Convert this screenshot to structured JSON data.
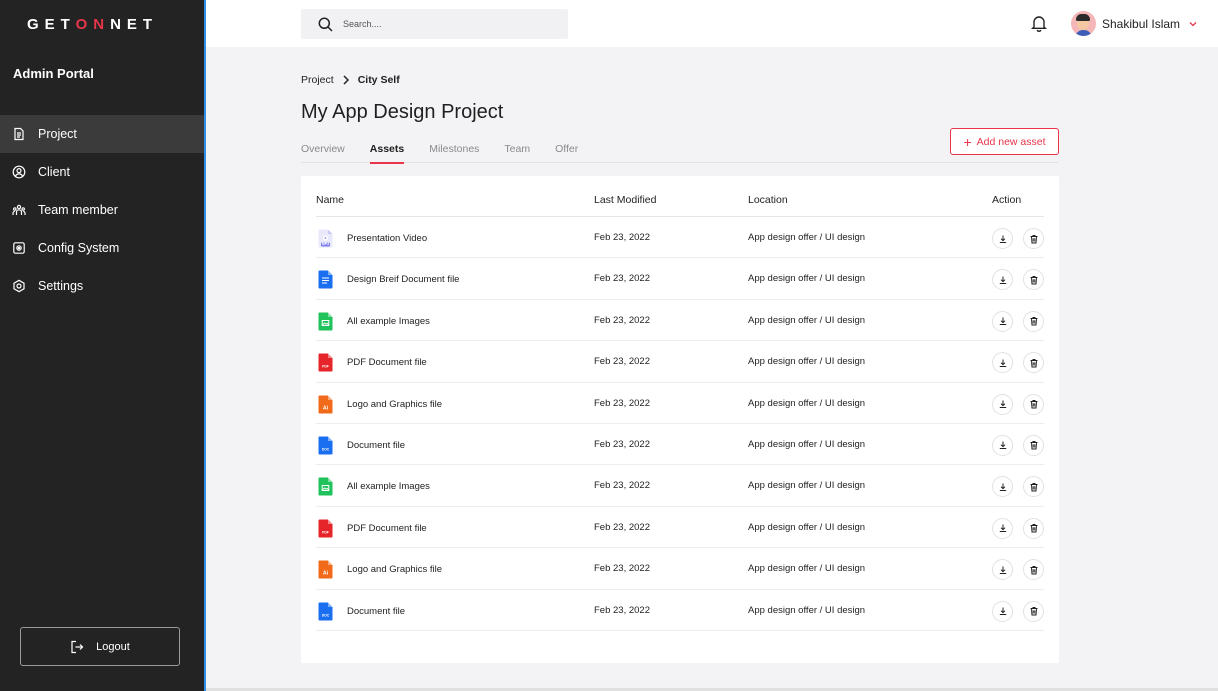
{
  "brand": {
    "logo_pre": "GET",
    "logo_accent": "ON",
    "logo_post": "NET",
    "portal": "Admin Portal"
  },
  "sidebar": {
    "items": [
      {
        "label": "Project",
        "icon": "document-icon"
      },
      {
        "label": "Client",
        "icon": "user-circle-icon"
      },
      {
        "label": "Team member",
        "icon": "team-icon"
      },
      {
        "label": "Config System",
        "icon": "config-icon"
      },
      {
        "label": "Settings",
        "icon": "settings-icon"
      }
    ],
    "logout": "Logout"
  },
  "topbar": {
    "search_placeholder": "Search....",
    "user_name": "Shakibul Islam"
  },
  "breadcrumb": {
    "parent": "Project",
    "current": "City Self"
  },
  "page": {
    "title": "My App Design Project",
    "add_button": "Add new asset"
  },
  "tabs": [
    "Overview",
    "Assets",
    "Milestones",
    "Team",
    "Offer"
  ],
  "table": {
    "headers": {
      "name": "Name",
      "modified": "Last Modified",
      "location": "Location",
      "action": "Action"
    },
    "rows": [
      {
        "name": "Presentation Video",
        "date": "Feb 23, 2022",
        "location": "App design offer / UI design",
        "type": "video",
        "badge": "MP4"
      },
      {
        "name": "Design Breif Document file",
        "date": "Feb 23, 2022",
        "location": "App design offer / UI design",
        "type": "docs",
        "badge": ""
      },
      {
        "name": "All example Images",
        "date": "Feb 23, 2022",
        "location": "App design offer / UI design",
        "type": "image",
        "badge": ""
      },
      {
        "name": "PDF Document file",
        "date": "Feb 23, 2022",
        "location": "App design offer / UI design",
        "type": "pdf",
        "badge": "PDF"
      },
      {
        "name": "Logo and Graphics file",
        "date": "Feb 23, 2022",
        "location": "App design offer / UI design",
        "type": "ai",
        "badge": "Ai"
      },
      {
        "name": "Document file",
        "date": "Feb 23, 2022",
        "location": "App design offer / UI design",
        "type": "doc",
        "badge": "DOC"
      },
      {
        "name": "All example Images",
        "date": "Feb 23, 2022",
        "location": "App design offer / UI design",
        "type": "image",
        "badge": ""
      },
      {
        "name": "PDF Document file",
        "date": "Feb 23, 2022",
        "location": "App design offer / UI design",
        "type": "pdf",
        "badge": "PDF"
      },
      {
        "name": "Logo and Graphics file",
        "date": "Feb 23, 2022",
        "location": "App design offer / UI design",
        "type": "ai",
        "badge": "Ai"
      },
      {
        "name": "Document file",
        "date": "Feb 23, 2022",
        "location": "App design offer / UI design",
        "type": "doc",
        "badge": "DOC"
      }
    ]
  },
  "colors": {
    "accent": "#e8354a",
    "sidebar_bg": "#232323",
    "video": "#7b7ff0",
    "docs": "#1a6ff0",
    "image": "#1fc25b",
    "pdf": "#e5252a",
    "ai": "#f06a1a",
    "doc": "#1a6ff0"
  }
}
